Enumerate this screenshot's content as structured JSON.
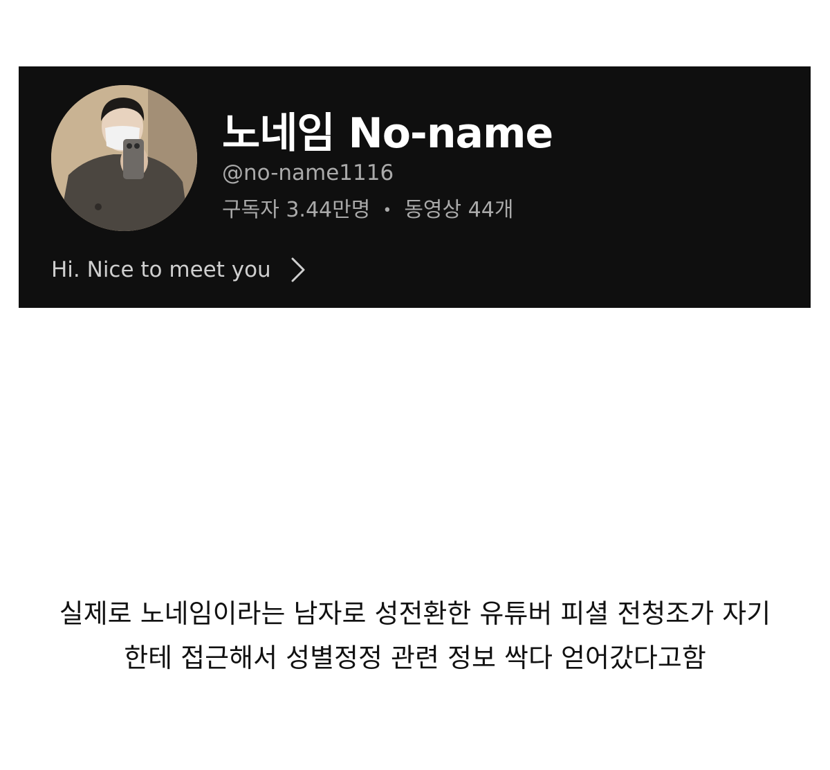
{
  "channel": {
    "name": "노네임 No-name",
    "handle": "@no-name1116",
    "subscribers": "구독자 3.44만명",
    "separator": "•",
    "videos": "동영상 44개",
    "description": "Hi. Nice to meet you"
  },
  "icons": {
    "avatar": "profile-photo",
    "more": "chevron-right-icon"
  },
  "caption": {
    "line1": "실제로 노네임이라는 남자로 성전환한 유튜버 피셜 전청조가 자기",
    "line2": "한테 접근해서 성별정정 관련 정보 싹다 얻어갔다고함"
  }
}
